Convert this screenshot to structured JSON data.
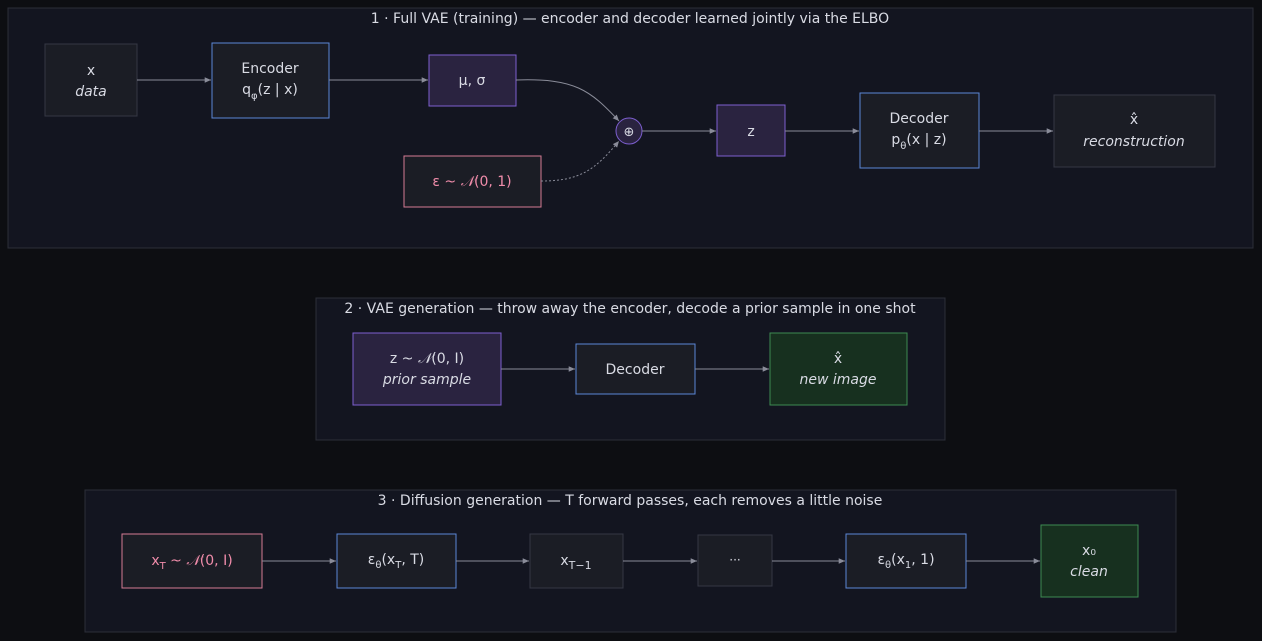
{
  "colors": {
    "background": "#0d0e12",
    "panel_fill": "#131520",
    "panel_stroke": "#2c2e38",
    "text": "#d9dbe4",
    "arrow": "#8a8c99",
    "neutral_fill": "#1b1d25",
    "neutral_stroke": "#353844",
    "blue_stroke": "#5b86d6",
    "purple_fill": "#2a2340",
    "purple_stroke": "#7d5fd0",
    "pink_stroke": "#d57a93",
    "pink_text": "#f08caa",
    "green_fill": "#17301f",
    "green_stroke": "#3e8a52"
  },
  "panel1": {
    "title": "1 · Full VAE (training) — encoder and decoder learned jointly via the ELBO",
    "x": {
      "main": "x",
      "sub": "data"
    },
    "encoder": {
      "main": "Encoder",
      "func": "q",
      "sub_letter": "φ",
      "args": "(z | x)"
    },
    "mu_sigma": "μ, σ",
    "eps": {
      "label": "ε ~ ",
      "dist": "𝒩",
      "args": "(0, 1)"
    },
    "combine": "⊕",
    "z": "z",
    "decoder": {
      "main": "Decoder",
      "func": "p",
      "sub_letter": "θ",
      "args": "(x | z)"
    },
    "xhat": {
      "main": "x̂",
      "sub": "reconstruction"
    }
  },
  "panel2": {
    "title": "2 · VAE generation — throw away the encoder, decode a prior sample in one shot",
    "prior": {
      "label": "z ~ ",
      "dist": "𝒩",
      "args": "(0, I)",
      "sub": "prior sample"
    },
    "decoder": "Decoder",
    "output": {
      "main": "x̂",
      "sub": "new image"
    }
  },
  "panel3": {
    "title": "3 · Diffusion generation — T forward passes, each removes a little noise",
    "xT": {
      "base": "x",
      "sub": "T",
      "label": " ~ ",
      "dist": "𝒩",
      "args": "(0, I)"
    },
    "step1": {
      "eps": "ε",
      "theta": "θ",
      "open": "(x",
      "xsub": "T",
      "close": ", T)"
    },
    "xTm1": {
      "base": "x",
      "sub": "T−1"
    },
    "ellipsis": "···",
    "step_last": {
      "eps": "ε",
      "theta": "θ",
      "open": "(x",
      "xsub": "1",
      "close": ", 1)"
    },
    "x0": {
      "main": "x₀",
      "sub": "clean"
    }
  }
}
